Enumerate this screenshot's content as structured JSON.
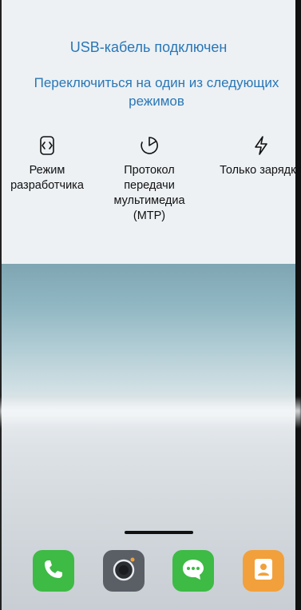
{
  "usb_dialog": {
    "title": "USB-кабель подключен",
    "subtitle": "Переключиться на один из следующих режимов",
    "modes": [
      {
        "label": "Режим разработчика",
        "icon": "developer-mode-icon"
      },
      {
        "label": "Протокол передачи мультимедиа (MTP)",
        "icon": "file-transfer-icon"
      },
      {
        "label": "Только зарядка",
        "icon": "charging-bolt-icon"
      }
    ]
  },
  "dock": {
    "apps": [
      {
        "name": "phone",
        "icon": "phone-icon",
        "color": "#3dbb45"
      },
      {
        "name": "camera",
        "icon": "camera-icon",
        "color": "#5a5f66"
      },
      {
        "name": "messages",
        "icon": "chat-icon",
        "color": "#3dbb45"
      },
      {
        "name": "contacts",
        "icon": "contacts-icon",
        "color": "#f2a03b"
      }
    ]
  },
  "colors": {
    "accent_text": "#2a77b6",
    "panel_bg": "#edf1f4"
  }
}
